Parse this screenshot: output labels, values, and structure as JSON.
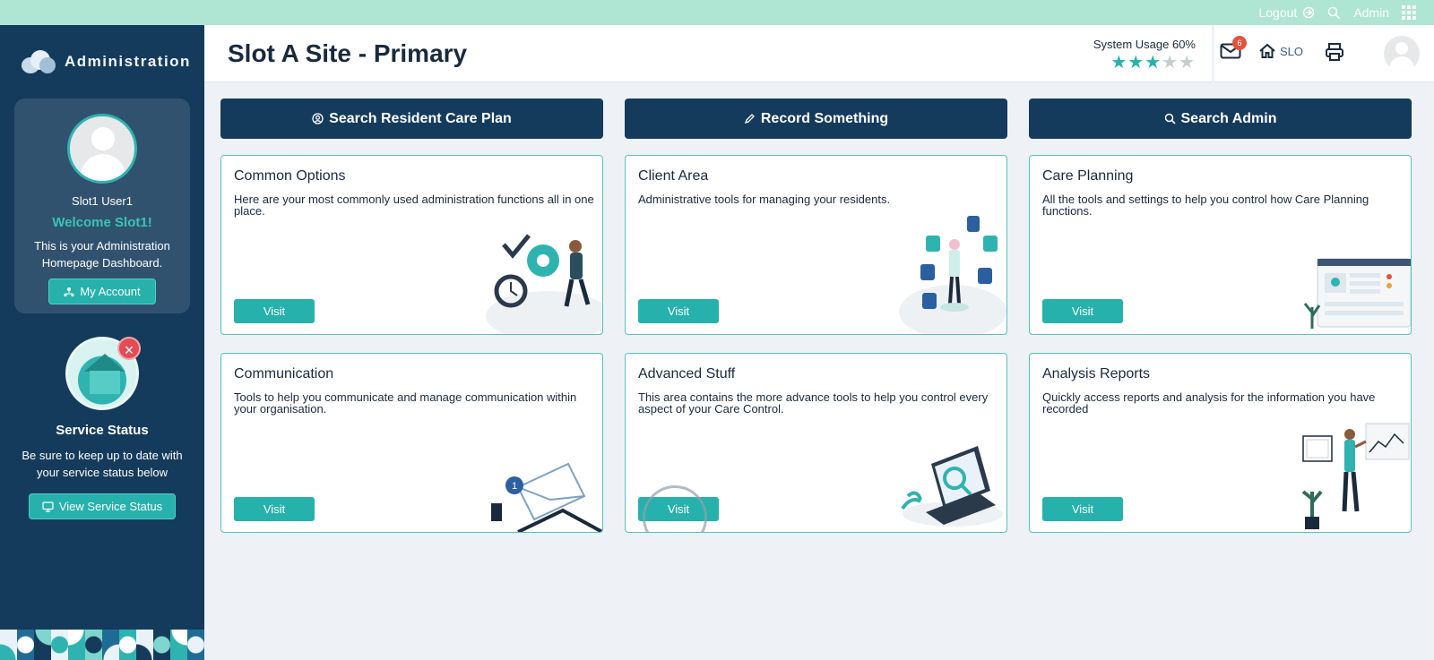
{
  "topbar": {
    "logout": "Logout",
    "admin": "Admin"
  },
  "sidebar": {
    "brand": "Administration",
    "user_name": "Slot1 User1",
    "welcome": "Welcome Slot1!",
    "description": "This is your Administration Homepage Dashboard.",
    "my_account": "My Account",
    "service_title": "Service Status",
    "service_desc": "Be sure to keep up to date with your service status below",
    "service_button": "View Service Status"
  },
  "header": {
    "title": "Slot A Site - Primary",
    "usage_label": "System Usage 60%",
    "stars": {
      "filled": 3,
      "total": 5
    },
    "mail_count": "6",
    "home_label": "SLO"
  },
  "actions": [
    {
      "label": "Search Resident Care Plan",
      "icon": "user-circle-icon"
    },
    {
      "label": "Record Something",
      "icon": "pencil-icon"
    },
    {
      "label": "Search Admin",
      "icon": "search-icon"
    }
  ],
  "cards": [
    {
      "title": "Common Options",
      "desc": "Here are your most commonly used administration functions all in one place.",
      "button": "Visit"
    },
    {
      "title": "Client Area",
      "desc": "Administrative tools for managing your residents.",
      "button": "Visit"
    },
    {
      "title": "Care Planning",
      "desc": "All the tools and settings to help you control how Care Planning functions.",
      "button": "Visit"
    },
    {
      "title": "Communication",
      "desc": "Tools to help you communicate and manage communication within your organisation.",
      "button": "Visit"
    },
    {
      "title": "Advanced Stuff",
      "desc": "This area contains the more advance tools to help you control every aspect of your Care Control.",
      "button": "Visit"
    },
    {
      "title": "Analysis Reports",
      "desc": "Quickly access reports and analysis for the information you have recorded",
      "button": "Visit"
    }
  ],
  "colors": {
    "navy": "#153b5c",
    "teal": "#27b1ac",
    "mint": "#aee6d3",
    "badge": "#e0533d"
  }
}
